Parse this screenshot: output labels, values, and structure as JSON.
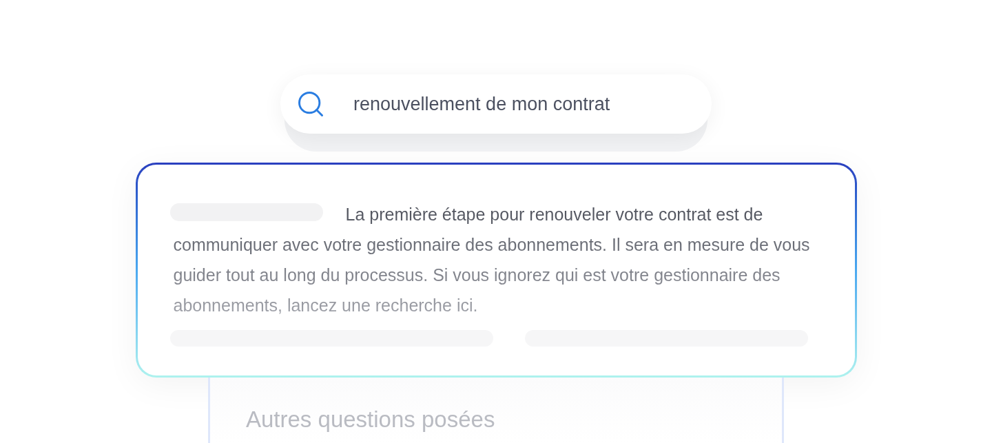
{
  "search": {
    "value": "renouvellement de mon contrat"
  },
  "answer": {
    "text": "La première étape pour renouveler votre contrat est de communiquer avec votre gestionnaire des abonnements. Il sera en mesure de vous guider tout au long du processus. Si vous ignorez qui est votre gestionnaire des abonnements, lancez une recherche ici."
  },
  "related": {
    "title": "Autres questions posées"
  }
}
